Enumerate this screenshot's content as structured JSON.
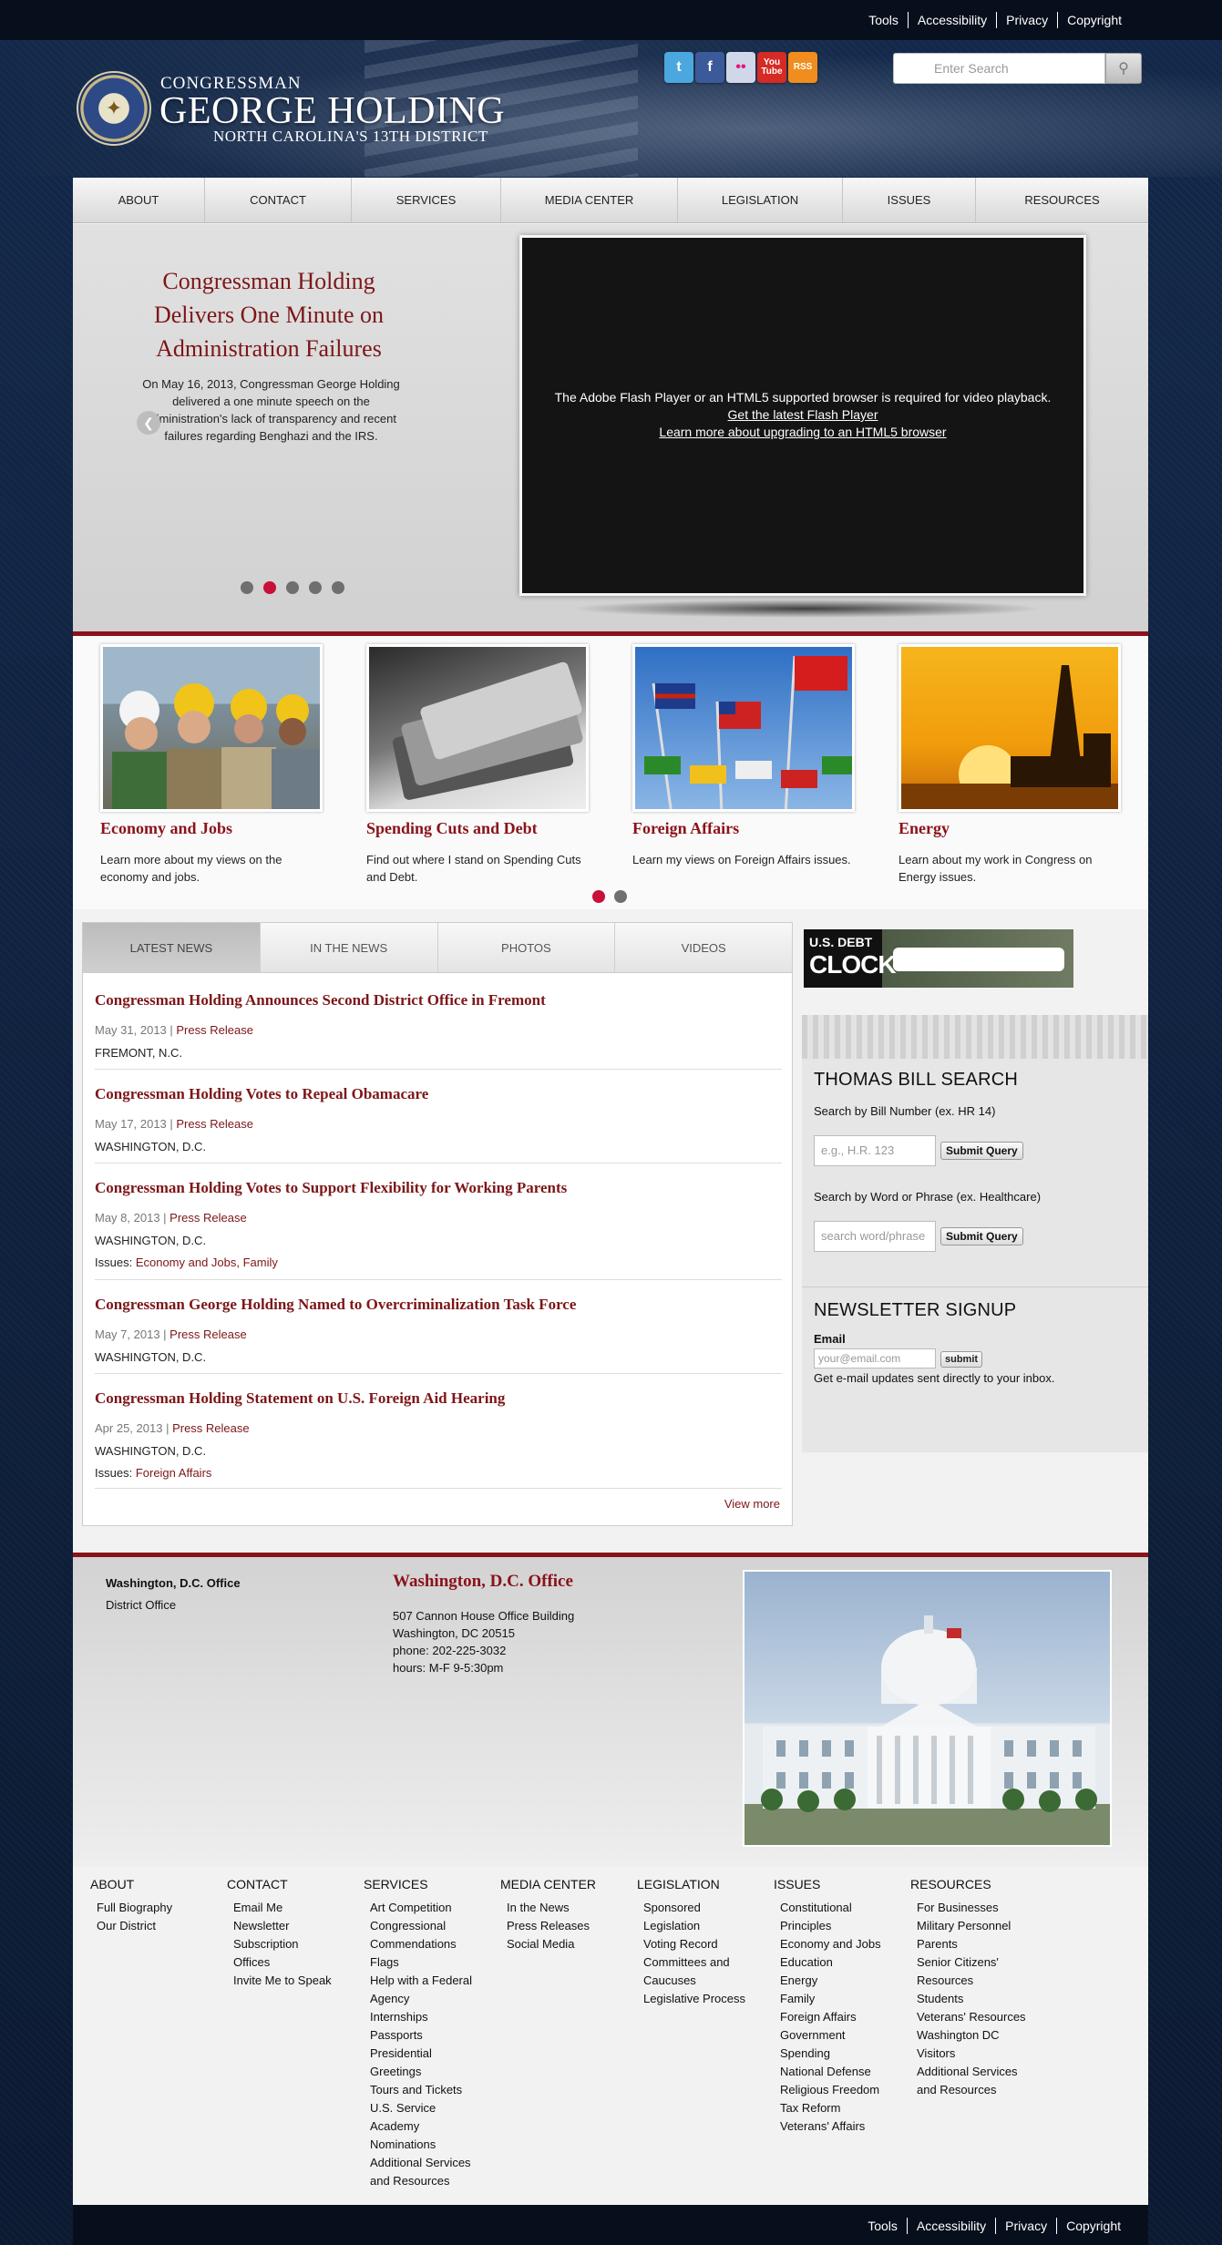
{
  "utility_links": [
    "Tools",
    "Accessibility",
    "Privacy",
    "Copyright"
  ],
  "brand": {
    "line1": "CONGRESSMAN",
    "line2": "GEORGE HOLDING",
    "line3": "NORTH CAROLINA'S 13TH DISTRICT",
    "seal_text": "U.S. HOUSE OF REPRESENTATIVES"
  },
  "social": [
    {
      "name": "twitter",
      "label": "t",
      "color": "#4aa8de"
    },
    {
      "name": "facebook",
      "label": "f",
      "color": "#3b5a9a"
    },
    {
      "name": "flickr",
      "label": "••",
      "color": "#cfd7e8"
    },
    {
      "name": "youtube",
      "label": "You Tube",
      "color": "#d62a24"
    },
    {
      "name": "rss",
      "label": "RSS",
      "color": "#f08d1e"
    }
  ],
  "search": {
    "placeholder": "Enter Search"
  },
  "nav": [
    "ABOUT",
    "CONTACT",
    "SERVICES",
    "MEDIA CENTER",
    "LEGISLATION",
    "ISSUES",
    "RESOURCES"
  ],
  "hero": {
    "title": "Congressman Holding Delivers One Minute on Administration Failures",
    "text": "On May 16, 2013, Congressman George Holding delivered a one minute speech on the administration's lack of transparency and recent failures regarding Benghazi and the IRS.",
    "slide_count": 5,
    "active_slide": 2,
    "video_message": "The Adobe Flash Player or an HTML5 supported browser is required for video playback.",
    "video_link1": "Get the latest Flash Player",
    "video_link2": "Learn more about upgrading to an HTML5 browser"
  },
  "issues": [
    {
      "title": "Economy and Jobs",
      "text": "Learn more about my views on the economy and jobs."
    },
    {
      "title": "Spending Cuts and Debt",
      "text": "Find out where I stand on Spending Cuts and Debt."
    },
    {
      "title": "Foreign Affairs",
      "text": "Learn my views on Foreign Affairs issues."
    },
    {
      "title": "Energy",
      "text": "Learn about my work in Congress on Energy issues."
    }
  ],
  "issues_pager": {
    "count": 2,
    "active": 1
  },
  "tabs": [
    "LATEST NEWS",
    "IN THE NEWS",
    "PHOTOS",
    "VIDEOS"
  ],
  "news": [
    {
      "title": "Congressman Holding Announces Second District Office in Fremont",
      "date": "May 31, 2013",
      "category": "Press Release",
      "location": "FREMONT, N.C.",
      "issues_label": "",
      "issues": ""
    },
    {
      "title": "Congressman Holding Votes to Repeal Obamacare",
      "date": "May 17, 2013",
      "category": "Press Release",
      "location": "WASHINGTON, D.C.",
      "issues_label": "",
      "issues": ""
    },
    {
      "title": "Congressman Holding Votes to Support Flexibility for Working Parents",
      "date": "May 8, 2013",
      "category": "Press Release",
      "location": "WASHINGTON, D.C.",
      "issues_label": "Issues:",
      "issues": "Economy and Jobs, Family"
    },
    {
      "title": "Congressman George Holding Named to Overcriminalization Task Force",
      "date": "May 7, 2013",
      "category": "Press Release",
      "location": "WASHINGTON, D.C.",
      "issues_label": "",
      "issues": ""
    },
    {
      "title": "Congressman Holding Statement on U.S. Foreign Aid Hearing",
      "date": "Apr 25, 2013",
      "category": "Press Release",
      "location": "WASHINGTON, D.C.",
      "issues_label": "Issues:",
      "issues": "Foreign Affairs"
    }
  ],
  "view_more": "View more",
  "debt_clock": {
    "line1": "U.S. DEBT",
    "line2": "CLOCK"
  },
  "thomas": {
    "heading": "THOMAS BILL SEARCH",
    "bill_label": "Search by Bill Number (ex. HR 14)",
    "bill_placeholder": "e.g., H.R. 123",
    "word_label": "Search by Word or Phrase (ex. Healthcare)",
    "word_placeholder": "search word/phrase",
    "submit": "Submit Query"
  },
  "newsletter": {
    "heading": "NEWSLETTER SIGNUP",
    "email_label": "Email",
    "email_placeholder": "your@email.com",
    "submit": "submit",
    "note": "Get e-mail updates sent directly to your inbox."
  },
  "office": {
    "tab_active": "Washington, D.C. Office",
    "tab_other": "District Office",
    "heading": "Washington, D.C. Office",
    "address1": "507 Cannon House Office Building",
    "address2": "Washington, DC 20515",
    "phone": "phone: 202-225-3032",
    "hours": "hours: M-F 9-5:30pm"
  },
  "sitemap": [
    {
      "heading": "ABOUT",
      "items": [
        "Full Biography",
        "Our District"
      ]
    },
    {
      "heading": "CONTACT",
      "items": [
        "Email Me",
        "Newsletter Subscription",
        "Offices",
        "Invite Me to Speak"
      ]
    },
    {
      "heading": "SERVICES",
      "items": [
        "Art Competition",
        "Congressional Commendations",
        "Flags",
        "Help with a Federal Agency",
        "Internships",
        "Passports",
        "Presidential Greetings",
        "Tours and Tickets",
        "U.S. Service Academy Nominations",
        "Additional Services and Resources"
      ]
    },
    {
      "heading": "MEDIA CENTER",
      "items": [
        "In the News",
        "Press Releases",
        "Social Media"
      ]
    },
    {
      "heading": "LEGISLATION",
      "items": [
        "Sponsored Legislation",
        "Voting Record",
        "Committees and Caucuses",
        "Legislative Process"
      ]
    },
    {
      "heading": "ISSUES",
      "items": [
        "Constitutional Principles",
        "Economy and Jobs",
        "Education",
        "Energy",
        "Family",
        "Foreign Affairs",
        "Government Spending",
        "National Defense",
        "Religious Freedom",
        "Tax Reform",
        "Veterans' Affairs"
      ]
    },
    {
      "heading": "RESOURCES",
      "items": [
        "For Businesses",
        "Military Personnel Parents",
        "Senior Citizens' Resources",
        "Students",
        "Veterans' Resources",
        "Washington DC Visitors",
        "Additional Services and Resources"
      ]
    }
  ]
}
